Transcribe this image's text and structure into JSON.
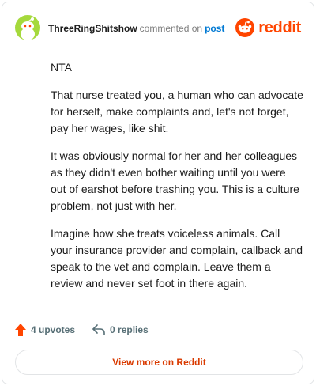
{
  "comment": {
    "username": "ThreeRingShitshow",
    "action_text": "commented on",
    "post_link": "post",
    "brand": "reddit",
    "paragraphs": [
      "NTA",
      "That nurse treated you, a human who can advocate for herself, make complaints and, let's not forget, pay her wages, like shit.",
      "It was obviously normal for her and her colleagues as they didn't even bother waiting until you were out of earshot before trashing you. This is a culture problem, not just with her.",
      "Imagine how she treats voiceless animals. Call your insurance provider and complain, callback and speak to the vet and complain. Leave them a review and never set foot in there again."
    ]
  },
  "footer": {
    "upvotes_label": "4 upvotes",
    "replies_label": "0 replies",
    "view_more_label": "View more on Reddit"
  },
  "colors": {
    "brand": "#ff4500",
    "avatar_bg": "#a5d93c",
    "link": "#0079d3"
  },
  "icons": {
    "avatar": "snoo-avatar-icon",
    "logo": "reddit-logo-icon",
    "upvote": "upvote-arrow-icon",
    "reply": "reply-arrow-icon"
  }
}
